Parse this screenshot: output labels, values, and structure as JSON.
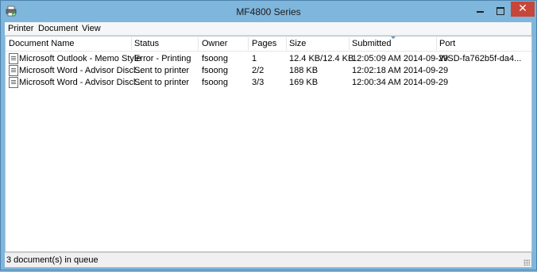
{
  "window": {
    "title": "MF4800 Series",
    "close_glyph": "✕"
  },
  "menu": {
    "items": [
      "Printer",
      "Document",
      "View"
    ]
  },
  "columns": [
    "Document Name",
    "Status",
    "Owner",
    "Pages",
    "Size",
    "Submitted",
    "Port"
  ],
  "rows": [
    {
      "name": "Microsoft Outlook - Memo Style",
      "status": "Error - Printing",
      "owner": "fsoong",
      "pages": "1",
      "size": "12.4 KB/12.4 KB",
      "submitted": "12:05:09 AM  2014-09-29",
      "port": "WSD-fa762b5f-da4..."
    },
    {
      "name": "Microsoft Word - Advisor Discl...",
      "status": "Sent to printer",
      "owner": "fsoong",
      "pages": "2/2",
      "size": "188 KB",
      "submitted": "12:02:18 AM  2014-09-29",
      "port": ""
    },
    {
      "name": "Microsoft Word - Advisor Discl...",
      "status": "Sent to printer",
      "owner": "fsoong",
      "pages": "3/3",
      "size": "169 KB",
      "submitted": "12:00:34 AM  2014-09-29",
      "port": ""
    }
  ],
  "status_bar": {
    "text": "3 document(s) in queue"
  },
  "icons": {
    "app": "printer-icon",
    "document": "document-icon",
    "sort": "sort-ascending-icon",
    "grip": "resize-grip-icon"
  },
  "colors": {
    "titlebar": "#7fb6db",
    "close_button": "#c7463a",
    "sort_arrow": "#5a8ec4"
  }
}
